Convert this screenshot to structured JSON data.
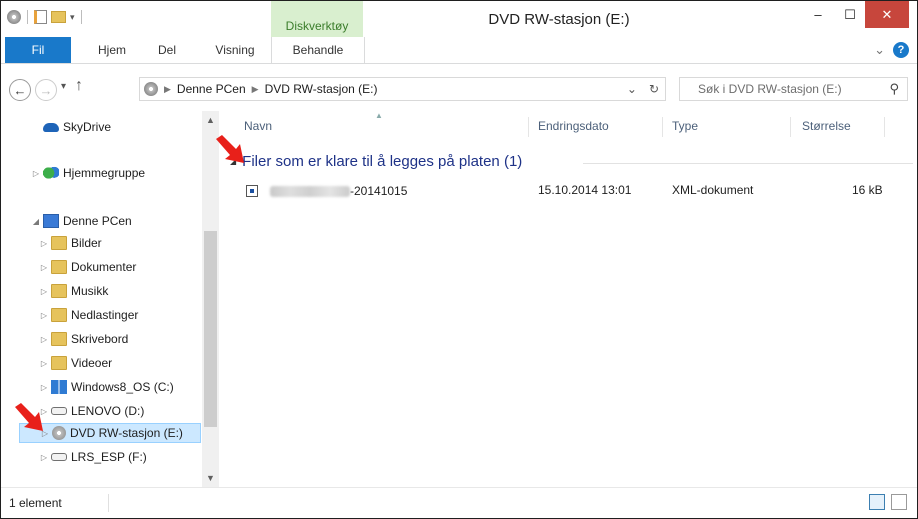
{
  "window": {
    "title": "DVD RW-stasjon (E:)",
    "context_tab": "Diskverktøy",
    "controls": {
      "minimize": "–",
      "maximize": "☐",
      "close": "✕"
    }
  },
  "ribbon": {
    "tabs": [
      "Fil",
      "Hjem",
      "Del",
      "Visning",
      "Behandle"
    ],
    "expand": "⌄",
    "help": "?"
  },
  "address": {
    "crumbs": [
      "Denne PCen",
      "DVD RW-stasjon (E:)"
    ],
    "dropdown": "⌄",
    "refresh": "↻",
    "search_placeholder": "Søk i DVD RW-stasjon (E:)"
  },
  "nav": {
    "back": "←",
    "forward": "→",
    "recent": "▾",
    "up": "↑"
  },
  "navpane": {
    "items": [
      {
        "label": "SkyDrive"
      },
      {
        "label": "Hjemmegruppe"
      },
      {
        "label": "Denne PCen"
      },
      {
        "label": "Bilder"
      },
      {
        "label": "Dokumenter"
      },
      {
        "label": "Musikk"
      },
      {
        "label": "Nedlastinger"
      },
      {
        "label": "Skrivebord"
      },
      {
        "label": "Videoer"
      },
      {
        "label": "Windows8_OS (C:)"
      },
      {
        "label": "LENOVO (D:)"
      },
      {
        "label": "DVD RW-stasjon (E:)"
      },
      {
        "label": "LRS_ESP (F:)"
      }
    ]
  },
  "columns": {
    "name": "Navn",
    "date": "Endringsdato",
    "type": "Type",
    "size": "Størrelse"
  },
  "group": {
    "header": "Filer som er klare til å legges på platen (1)"
  },
  "files": [
    {
      "name_suffix": "-20141015",
      "date": "15.10.2014 13:01",
      "type": "XML-dokument",
      "size": "16 kB"
    }
  ],
  "status": {
    "count": "1 element"
  },
  "colors": {
    "accent": "#1979ca",
    "context_tab_bg": "#d9efcf",
    "group_header": "#1e3287",
    "selection": "#cce8ff",
    "annotation_arrow": "#e8201a"
  }
}
